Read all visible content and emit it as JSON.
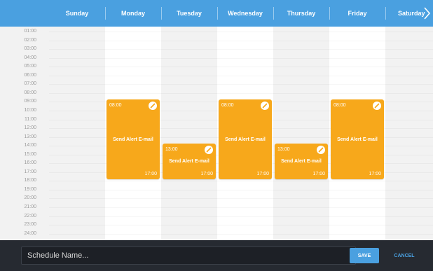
{
  "header": {
    "days": [
      "Sunday",
      "Monday",
      "Tuesday",
      "Wednesday",
      "Thursday",
      "Friday",
      "Saturday"
    ],
    "next_icon": "chevron-right-icon"
  },
  "hours": [
    "01:00",
    "02:00",
    "03:00",
    "04:00",
    "05:00",
    "06:00",
    "07:00",
    "08:00",
    "09:00",
    "10:00",
    "11:00",
    "12:00",
    "13:00",
    "14:00",
    "15:00",
    "16:00",
    "17:00",
    "18:00",
    "19:00",
    "20:00",
    "21:00",
    "22:00",
    "23:00",
    "24:00"
  ],
  "events": [
    {
      "day": "Monday",
      "start": "08:00",
      "end": "17:00",
      "title": "Send Alert E-mail",
      "edit_icon": "pencil-icon"
    },
    {
      "day": "Tuesday",
      "start": "13:00",
      "end": "17:00",
      "title": "Send Alert E-mail",
      "edit_icon": "pencil-icon"
    },
    {
      "day": "Wednesday",
      "start": "08:00",
      "end": "17:00",
      "title": "Send Alert E-mail",
      "edit_icon": "pencil-icon"
    },
    {
      "day": "Thursday",
      "start": "13:00",
      "end": "17:00",
      "title": "Send Alert E-mail",
      "edit_icon": "pencil-icon"
    },
    {
      "day": "Friday",
      "start": "08:00",
      "end": "17:00",
      "title": "Send Alert E-mail",
      "edit_icon": "pencil-icon"
    }
  ],
  "footer": {
    "name_placeholder": "Schedule Name...",
    "name_value": "",
    "save_label": "SAVE",
    "cancel_label": "CANCEL"
  },
  "colors": {
    "header": "#4aa0e0",
    "event": "#f7a81b",
    "footer": "#262a31",
    "weekday_column": "#ffffff",
    "weekend_column": "#f2f2f2"
  }
}
